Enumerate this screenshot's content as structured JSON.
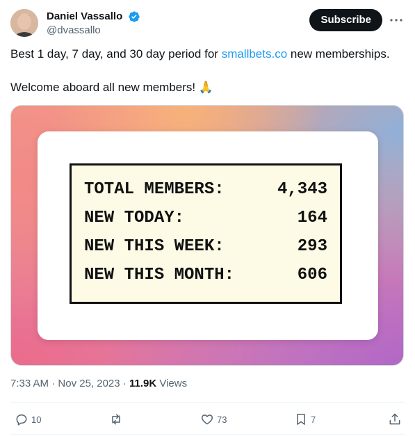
{
  "author": {
    "display_name": "Daniel Vassallo",
    "handle": "@dvassallo",
    "verified": true
  },
  "header": {
    "subscribe_label": "Subscribe"
  },
  "tweet": {
    "line1_before": "Best 1 day, 7 day, and 30 day period for ",
    "line1_link": "smallbets.co",
    "line1_after": " new memberships.",
    "line2": "Welcome aboard all new members! 🙏"
  },
  "stats": [
    {
      "label": "TOTAL MEMBERS:",
      "value": "4,343"
    },
    {
      "label": "NEW TODAY:",
      "value": "164"
    },
    {
      "label": "NEW THIS WEEK:",
      "value": "293"
    },
    {
      "label": "NEW THIS MONTH:",
      "value": "606"
    }
  ],
  "meta": {
    "time": "7:33 AM",
    "separator": " · ",
    "date": "Nov 25, 2023",
    "views_count": "11.9K",
    "views_label": " Views"
  },
  "actions": {
    "replies": "10",
    "reposts": "",
    "likes": "73",
    "bookmarks": "7"
  },
  "colors": {
    "link": "#1d9bf0",
    "verified": "#1d9bf0",
    "text": "#0f1419",
    "secondary": "#536471"
  }
}
